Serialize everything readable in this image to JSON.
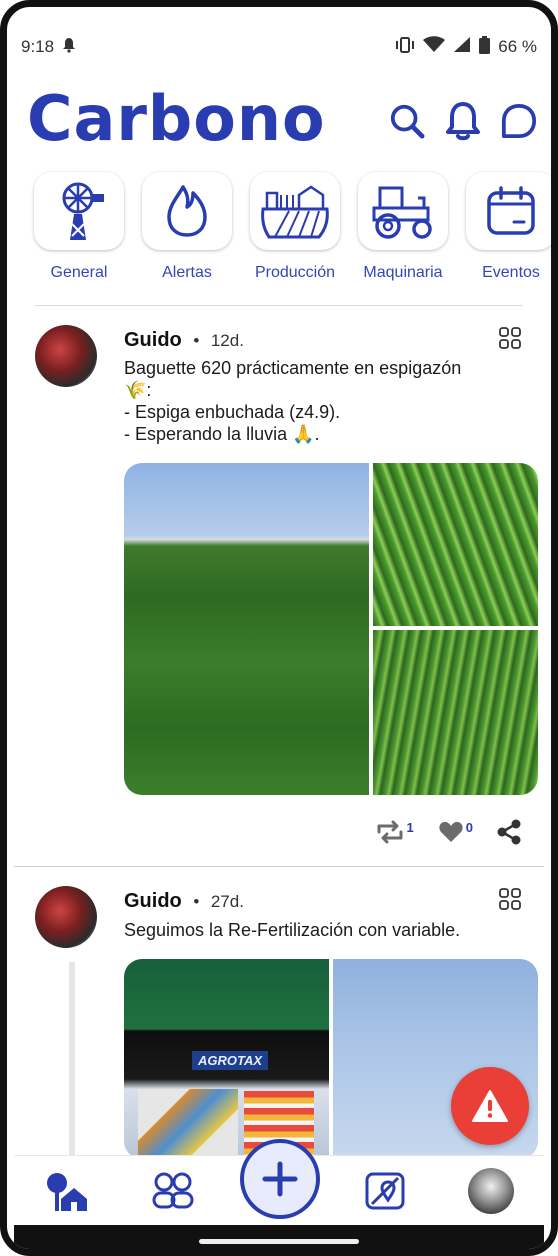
{
  "status": {
    "time": "9:18",
    "battery": "66 %"
  },
  "header": {
    "logo_text": "Carbono"
  },
  "categories": [
    {
      "label": "General",
      "icon": "windmill-icon"
    },
    {
      "label": "Alertas",
      "icon": "drop-icon"
    },
    {
      "label": "Producción",
      "icon": "barn-field-icon"
    },
    {
      "label": "Maquinaria",
      "icon": "tractor-icon"
    },
    {
      "label": "Eventos",
      "icon": "calendar-icon"
    }
  ],
  "posts": [
    {
      "author": "Guido",
      "ago": "12d.",
      "lines": [
        "Baguette 620 prácticamente en espigazón",
        "🌾:",
        "- Espiga enbuchada (z4.9).",
        "- Esperando la lluvia 🙏."
      ],
      "repost_count": "1",
      "like_count": "0"
    },
    {
      "author": "Guido",
      "ago": "27d.",
      "lines": [
        "Seguimos la Re-Fertilización con variable."
      ],
      "brand_on_screen": "AGROTAX"
    }
  ],
  "colors": {
    "brand": "#2a3db0",
    "alert": "#ea3f36"
  }
}
